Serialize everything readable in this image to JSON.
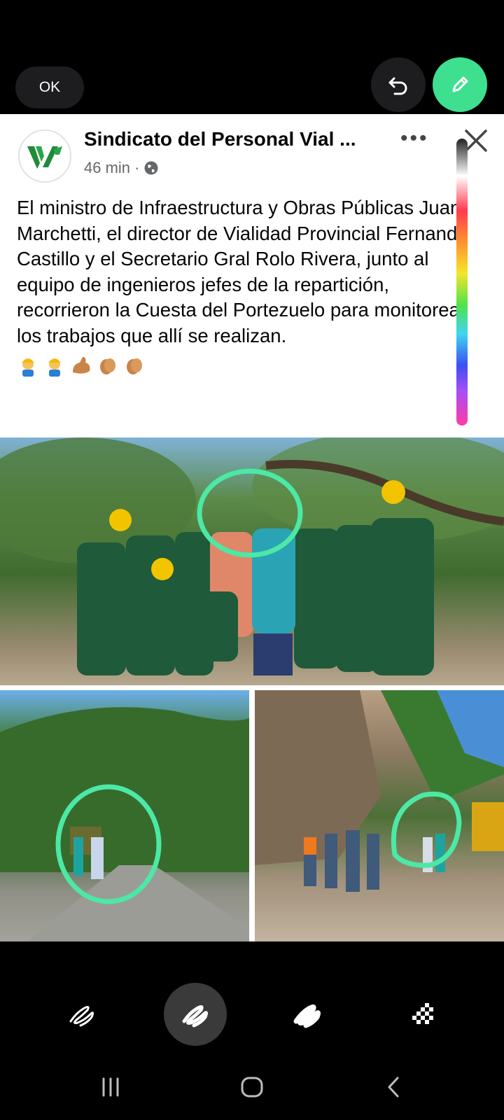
{
  "editor": {
    "ok_label": "OK",
    "undo_icon": "undo-icon",
    "pen_icon": "pencil-icon",
    "accent_color": "#3ee08f"
  },
  "post": {
    "page_name": "Sindicato del Personal Vial ...",
    "time": "46 min",
    "privacy_icon": "globe-icon",
    "text": "El ministro de Infraestructura y Obras Públicas Juan Marchetti, el director  de Vialidad Provincial Fernando Castillo y el Secretario Gral Rolo Rivera, junto al equipo de ingenieros jefes de la repartición,  recorrieron la Cuesta del Portezuelo para monitorear los trabajos que allí se realizan.",
    "emojis": [
      "construction-worker-emoji",
      "construction-worker-emoji",
      "flexed-biceps-emoji",
      "clapping-hands-emoji",
      "clapping-hands-emoji"
    ]
  },
  "tools": {
    "items": [
      "pen-tool-icon",
      "marker-tool-icon",
      "highlighter-tool-icon",
      "mosaic-tool-icon"
    ],
    "selected": "marker-tool-icon"
  },
  "nav": {
    "items": [
      "recent-apps-icon",
      "home-icon",
      "back-icon"
    ]
  }
}
